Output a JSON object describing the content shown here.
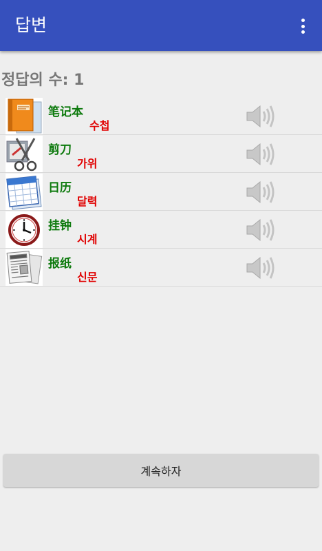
{
  "appbar": {
    "title": "답변",
    "menu_icon": "more-vert-icon"
  },
  "score": {
    "text": "정답의 수: 1"
  },
  "items": [
    {
      "chinese": "笔记本",
      "korean": "수첩",
      "icon": "notebook-icon"
    },
    {
      "chinese": "剪刀",
      "korean": "가위",
      "icon": "scissors-icon"
    },
    {
      "chinese": "日历",
      "korean": "달력",
      "icon": "calendar-icon"
    },
    {
      "chinese": "挂钟",
      "korean": "시계",
      "icon": "wall-clock-icon"
    },
    {
      "chinese": "报纸",
      "korean": "신문",
      "icon": "newspaper-icon"
    }
  ],
  "speaker_icon": "speaker-icon",
  "continue_button": {
    "label": "계속하자"
  },
  "colors": {
    "appbar": "#3650bd",
    "chinese_text": "#0d7a0d",
    "korean_text": "#e00000",
    "background": "#eeeeee"
  }
}
